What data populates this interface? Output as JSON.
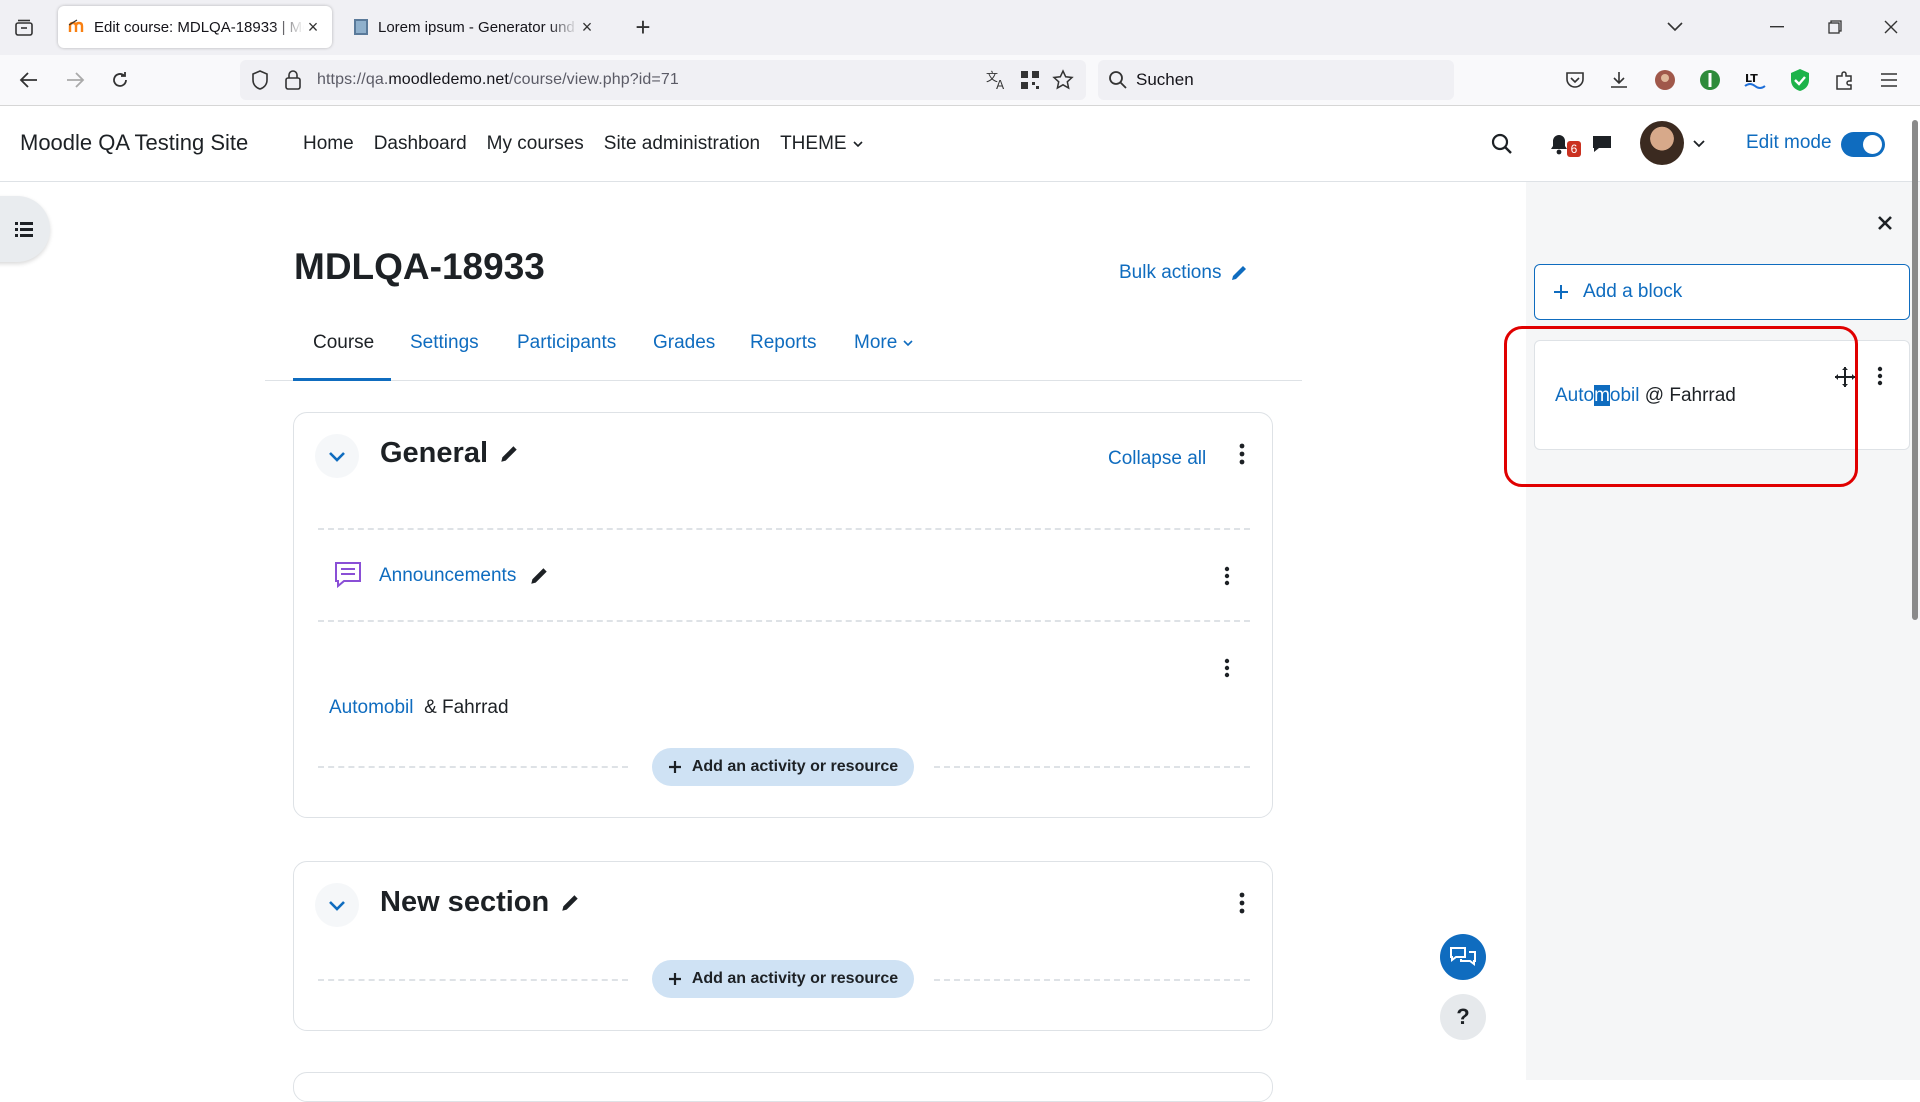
{
  "browser": {
    "tabs": [
      {
        "title": "Edit course: MDLQA-18933 | Moodle QA Testing Site",
        "active": true
      },
      {
        "title": "Lorem ipsum - Generator und Infos",
        "active": false
      }
    ],
    "url_prefix": "https://qa.",
    "url_domain": "moodledemo.net",
    "url_path": "/course/view.php?id=71",
    "search_placeholder": "Suchen"
  },
  "header": {
    "site_name": "Moodle QA Testing Site",
    "nav": [
      "Home",
      "Dashboard",
      "My courses",
      "Site administration",
      "THEME"
    ],
    "notification_count": "6",
    "edit_mode_label": "Edit mode",
    "edit_mode_on": true
  },
  "course": {
    "title": "MDLQA-18933",
    "bulk_actions": "Bulk actions",
    "tabs": [
      "Course",
      "Settings",
      "Participants",
      "Grades",
      "Reports",
      "More"
    ],
    "active_tab": "Course"
  },
  "sections": [
    {
      "title": "General",
      "collapse_all": "Collapse all",
      "activities": [
        {
          "name": "Announcements"
        }
      ],
      "text_link": "Automobil",
      "text_rest": "& Fahrrad",
      "add_label": "Add an activity or resource"
    },
    {
      "title": "New section",
      "add_label": "Add an activity or resource"
    }
  ],
  "drawer": {
    "add_block": "Add a block",
    "block_link_a": "Auto",
    "block_link_sel": "m",
    "block_link_b": "obil",
    "block_rest": "@ Fahrrad"
  },
  "colors": {
    "brand": "#0f6cbf",
    "highlight": "#e00000"
  }
}
